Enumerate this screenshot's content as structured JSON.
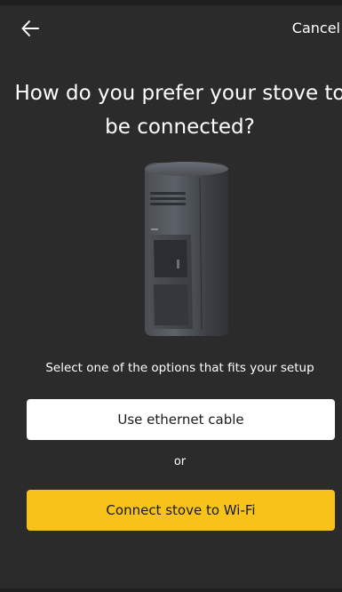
{
  "header": {
    "back_icon": "arrow-left-icon",
    "cancel_label": "Cancel"
  },
  "main": {
    "title": "How do you prefer your stove to be connected?",
    "stove_image": "stove-image",
    "instruction": "Select one of the options that fits your setup",
    "ethernet_button_label": "Use ethernet cable",
    "or_text": "or",
    "wifi_button_label": "Connect stove to Wi-Fi"
  },
  "colors": {
    "background": "#2b2b2b",
    "accent": "#f7c31b",
    "secondary_button": "#ffffff"
  }
}
